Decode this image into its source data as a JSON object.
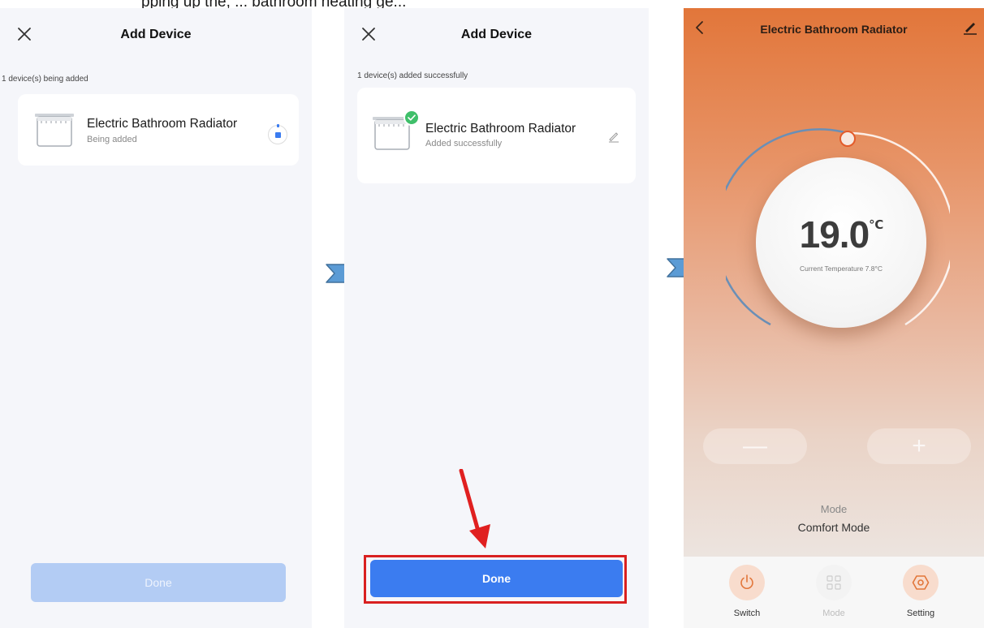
{
  "caption": {
    "fragment": "pping up the, ... bathroom heating ge..."
  },
  "screen1": {
    "title": "Add Device",
    "status": "1 device(s) being added",
    "device": {
      "name": "Electric Bathroom Radiator",
      "status": "Being added"
    },
    "done_label": "Done",
    "close_icon": "close-icon",
    "spinner_icon": "loading-icon"
  },
  "screen2": {
    "title": "Add Device",
    "status": "1 device(s) added successfully",
    "device": {
      "name": "Electric Bathroom Radiator",
      "status": "Added successfully"
    },
    "done_label": "Done",
    "edit_icon": "pencil-icon",
    "badge_icon": "check-icon"
  },
  "screen3": {
    "title": "Electric Bathroom Radiator",
    "target_temp": "19.0",
    "temp_unit": "℃",
    "current_temp_text": "Current Temperature 7.8°C",
    "minus_label": "—",
    "plus_label": "+",
    "mode_caption": "Mode",
    "mode_value": "Comfort Mode",
    "bottom_items": [
      {
        "label": "Switch",
        "icon": "power-icon"
      },
      {
        "label": "Mode",
        "icon": "grid-icon"
      },
      {
        "label": "Setting",
        "icon": "settings-hex-icon"
      }
    ]
  },
  "colors": {
    "primary_blue": "#3b7cf0",
    "disabled_blue": "#b3ccf4",
    "highlight_red": "#d92020",
    "success_green": "#3fbf6a",
    "heat_orange": "#e2763a"
  }
}
